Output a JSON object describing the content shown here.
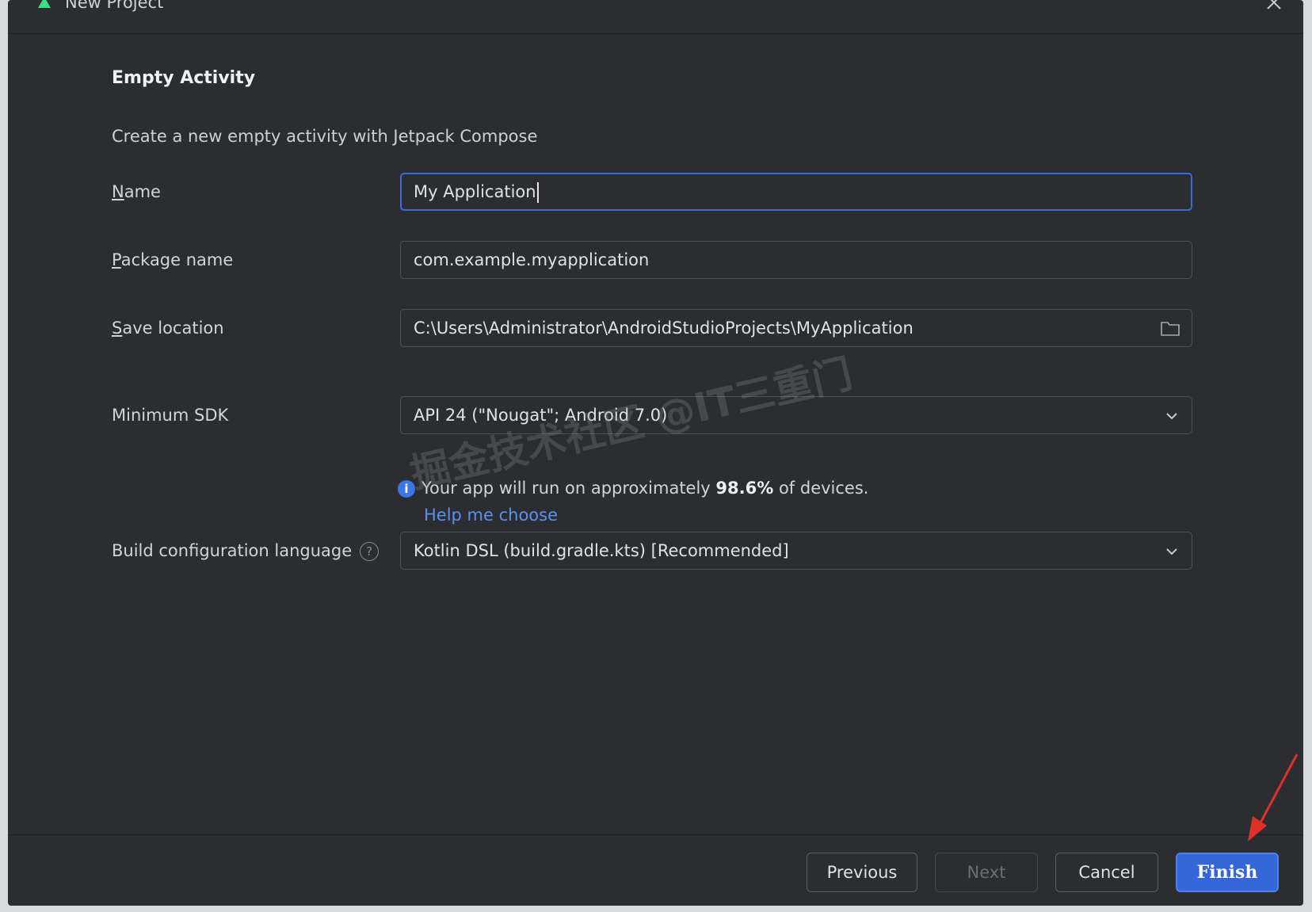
{
  "window": {
    "title": "New Project"
  },
  "section": {
    "title": "Empty Activity",
    "description": "Create a new empty activity with Jetpack Compose"
  },
  "form": {
    "name": {
      "label_mnemonic": "N",
      "label_rest": "ame",
      "value": "My Application"
    },
    "package_name": {
      "label_mnemonic": "P",
      "label_rest": "ackage name",
      "value": "com.example.myapplication"
    },
    "save_location": {
      "label_mnemonic": "S",
      "label_rest": "ave location",
      "value": "C:\\Users\\Administrator\\AndroidStudioProjects\\MyApplication",
      "icon": "folder-icon"
    },
    "minimum_sdk": {
      "label": "Minimum SDK",
      "value": "API 24 (\"Nougat\"; Android 7.0)",
      "icon": "chevron-down-icon"
    },
    "info": {
      "icon_glyph": "i",
      "text_before": "Your app will run on approximately ",
      "percent": "98.6%",
      "text_after": " of devices.",
      "help_link": "Help me choose"
    },
    "build_config": {
      "label": "Build configuration language",
      "help_glyph": "?",
      "value": "Kotlin DSL (build.gradle.kts) [Recommended]",
      "icon": "chevron-down-icon"
    }
  },
  "buttons": {
    "previous": "Previous",
    "next": "Next",
    "cancel": "Cancel",
    "finish": "Finish"
  },
  "watermark": "掘金技术社区 @IT三重门",
  "colors": {
    "background": "#2b2d30",
    "accent": "#3566d8",
    "focus_border": "#3d6ae0",
    "link": "#5c8ff0",
    "annotation_arrow": "#e0302a"
  }
}
